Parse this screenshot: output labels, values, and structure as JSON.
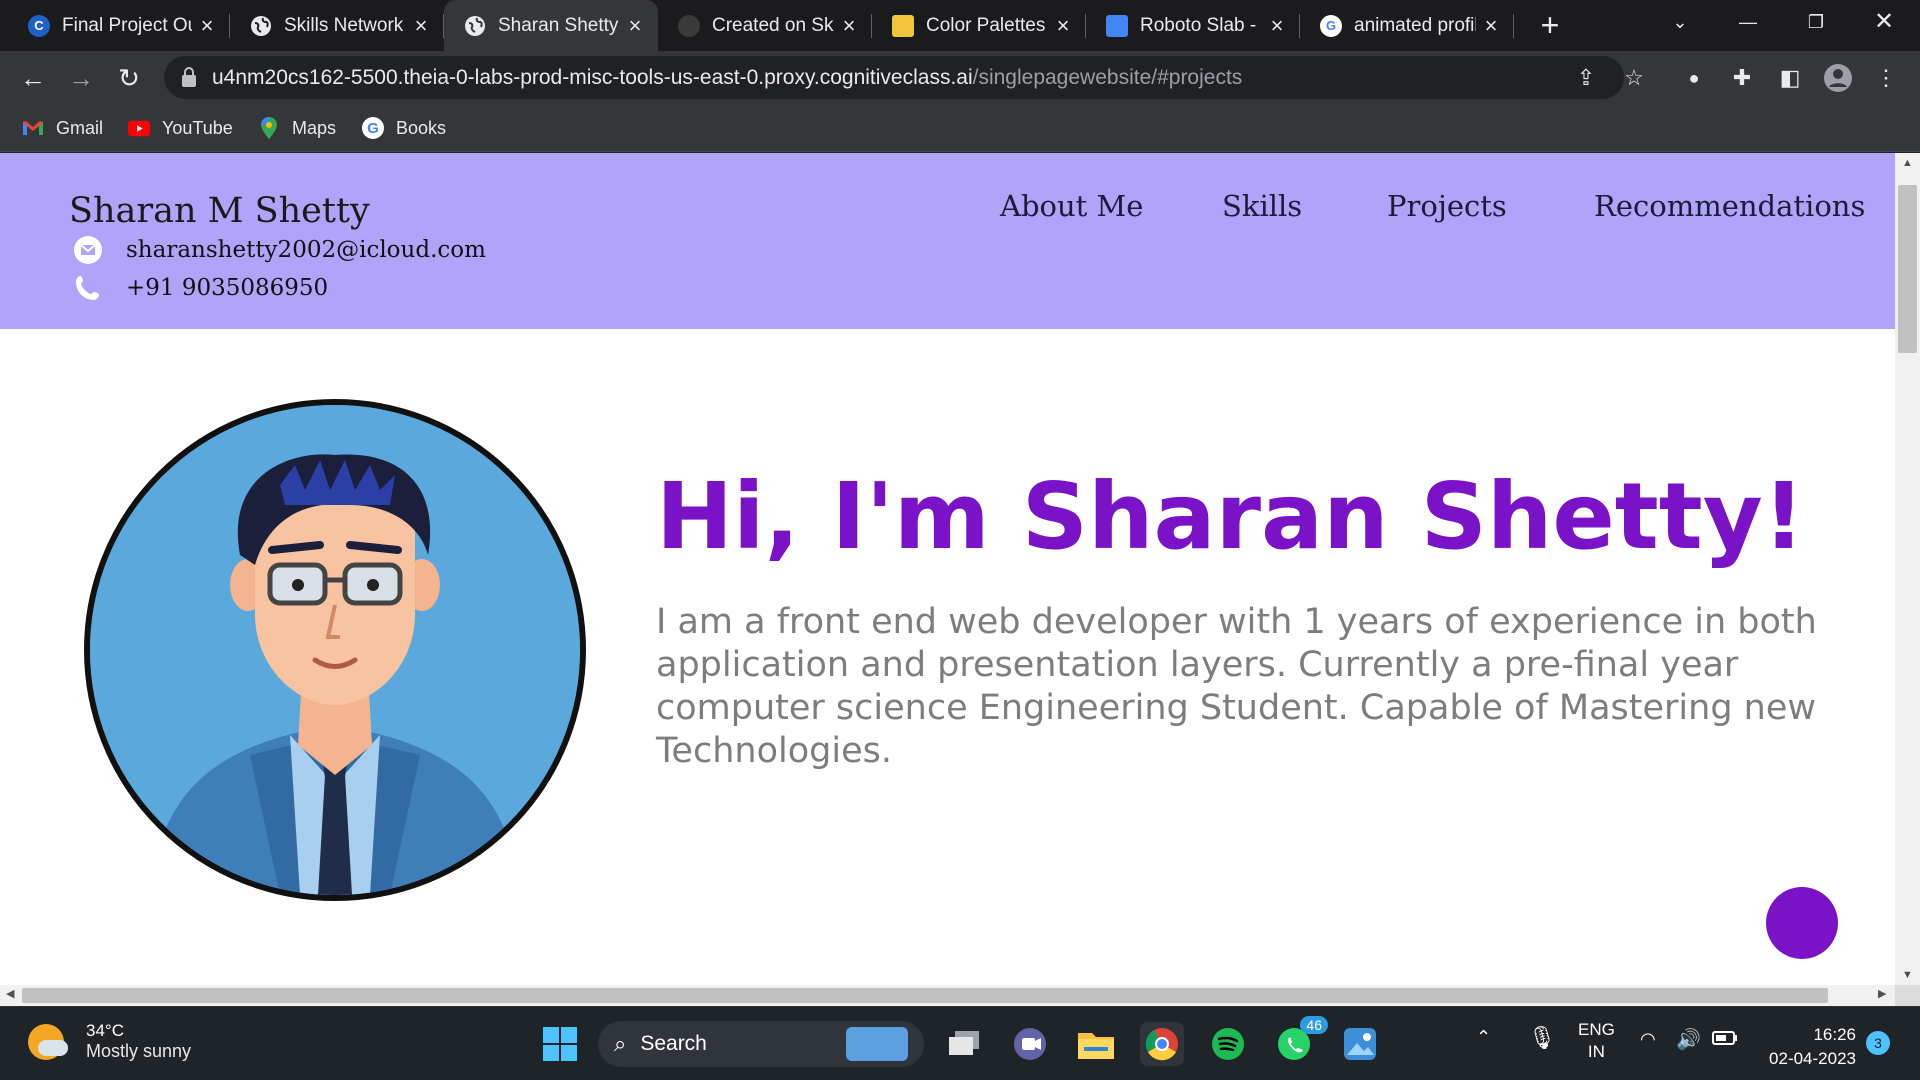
{
  "browser": {
    "tabs": [
      {
        "title": "Final Project Ou",
        "icon": "coursera-icon",
        "color": "#1f62c7",
        "glyph": "C"
      },
      {
        "title": "Skills Network",
        "icon": "globe-icon",
        "color": "#e8eaed",
        "glyph": ""
      },
      {
        "title": "Sharan Shetty",
        "icon": "globe-icon",
        "color": "#e8eaed",
        "glyph": "",
        "active": true
      },
      {
        "title": "Created on Skil",
        "icon": "github-icon",
        "color": "#3a3a3a",
        "glyph": ""
      },
      {
        "title": "Color Palettes",
        "icon": "palette-icon",
        "color": "#f2c63a",
        "glyph": ""
      },
      {
        "title": "Roboto Slab - G",
        "icon": "google-fonts-icon",
        "color": "#4285f4",
        "glyph": ""
      },
      {
        "title": "animated profil",
        "icon": "google-icon",
        "color": "#ffffff",
        "glyph": "G"
      }
    ],
    "url_host": "u4nm20cs162-5500.theia-0-labs-prod-misc-tools-us-east-0.proxy.cognitiveclass.ai",
    "url_path": "/singlepagewebsite/#projects",
    "bookmarks": [
      {
        "label": "Gmail",
        "icon": "gmail-icon"
      },
      {
        "label": "YouTube",
        "icon": "youtube-icon"
      },
      {
        "label": "Maps",
        "icon": "maps-icon"
      },
      {
        "label": "Books",
        "icon": "google-icon"
      }
    ]
  },
  "site": {
    "name": "Sharan M Shetty",
    "email": "sharanshetty2002@icloud.com",
    "phone": "+91 9035086950",
    "nav": [
      "About Me",
      "Skills",
      "Projects",
      "Recommendations"
    ],
    "hero_title": "Hi, I'm Sharan Shetty!",
    "hero_text": "I am a front end web developer with 1 years of experience in both application and presentation layers. Currently a pre-final year computer science Engineering Student. Capable of Mastering new Technologies.",
    "colors": {
      "header_bg": "#b1a3f9",
      "accent": "#7a12c7",
      "text_gray": "#7d7d7d"
    }
  },
  "taskbar": {
    "temperature": "34°C",
    "weather": "Mostly sunny",
    "search_label": "Search",
    "whatsapp_badge": "46",
    "language": "ENG",
    "region": "IN",
    "time": "16:26",
    "date": "02-04-2023",
    "notifications": "3"
  }
}
